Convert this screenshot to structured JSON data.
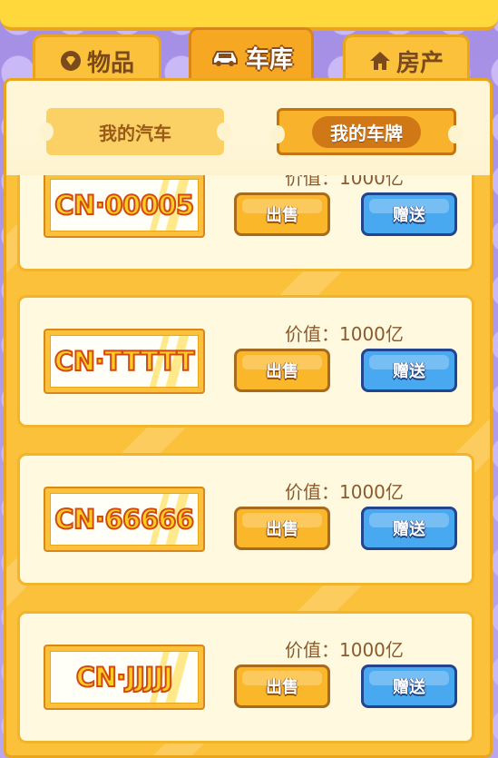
{
  "tabs": [
    {
      "label": "物品",
      "icon": "diamond-icon",
      "active": false
    },
    {
      "label": "车库",
      "icon": "car-icon",
      "active": true
    },
    {
      "label": "房产",
      "icon": "house-icon",
      "active": false
    }
  ],
  "subtabs": {
    "my_cars": "我的汽车",
    "my_plates": "我的车牌",
    "active": "my_plates"
  },
  "value_prefix": "价值：",
  "buttons": {
    "sell": "出售",
    "gift": "赠送"
  },
  "plates": [
    {
      "number": "CN·00005",
      "value": "1000亿"
    },
    {
      "number": "CN·TTTTT",
      "value": "1000亿"
    },
    {
      "number": "CN·66666",
      "value": "1000亿"
    },
    {
      "number": "CN·JJJJJ",
      "value": "1000亿"
    }
  ],
  "colors": {
    "gold": "#fbc13a",
    "gold_border": "#e9a51c",
    "card_bg": "#fff9df",
    "gift_blue": "#48a8f0",
    "plate_text": "#ffcd22",
    "plate_stroke": "#d14a12",
    "background_purple": "#b9a6ee"
  }
}
